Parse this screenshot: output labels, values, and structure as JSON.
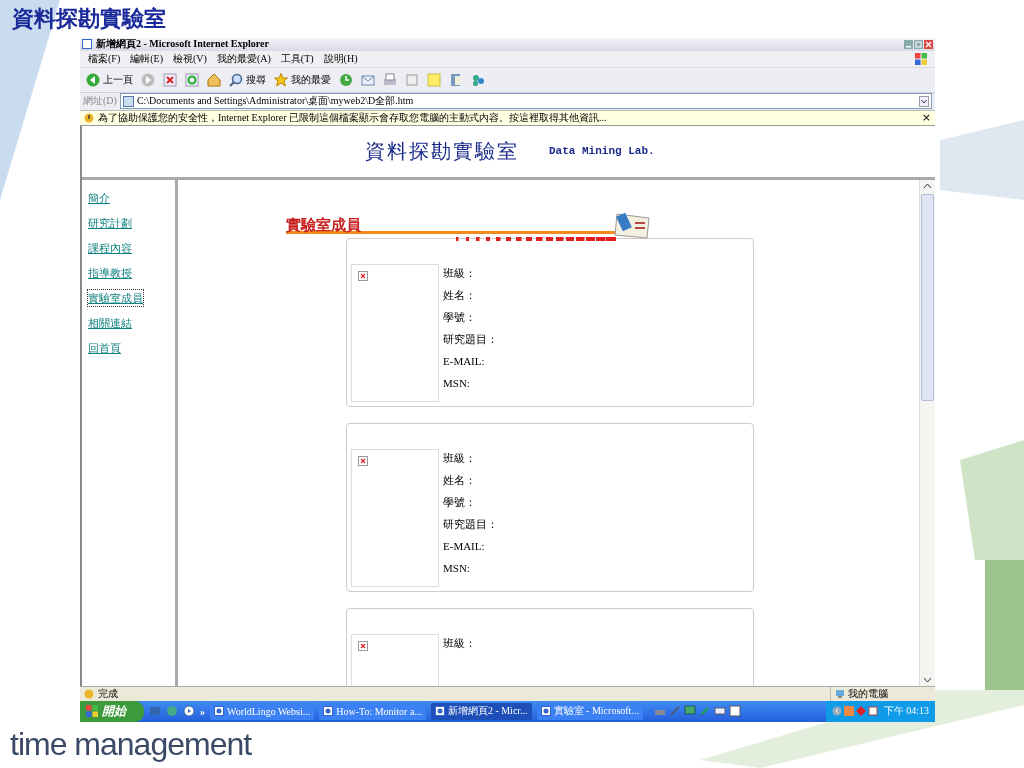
{
  "slide_title": "資料探勘實驗室",
  "window": {
    "title": "新增網頁2 - Microsoft Internet Explorer"
  },
  "menu": [
    "檔案(F)",
    "編輯(E)",
    "檢視(V)",
    "我的最愛(A)",
    "工具(T)",
    "說明(H)"
  ],
  "toolbar": [
    {
      "kind": "back",
      "label": "上一頁"
    },
    {
      "kind": "forward"
    },
    {
      "kind": "stop"
    },
    {
      "kind": "refresh"
    },
    {
      "kind": "home"
    },
    {
      "kind": "search",
      "label": "搜尋"
    },
    {
      "kind": "favorites",
      "label": "我的最愛"
    },
    {
      "kind": "history"
    },
    {
      "kind": "mail"
    },
    {
      "kind": "print"
    },
    {
      "kind": "edit"
    },
    {
      "kind": "notes"
    },
    {
      "kind": "research"
    },
    {
      "kind": "messenger"
    }
  ],
  "address": {
    "label": "網址(D)",
    "value": "C:\\Documents and Settings\\Administrator\\桌面\\myweb2\\D全部.htm"
  },
  "info_bar": {
    "text": "為了協助保護您的安全性，Internet Explorer 已限制這個檔案顯示會存取您電腦的主動式內容。按這裡取得其他資訊...",
    "close": "×"
  },
  "page": {
    "title": "資料探勘實驗室",
    "subtitle": "Data Mining Lab.",
    "nav": [
      {
        "label": "簡介",
        "selected": false
      },
      {
        "label": "研究計劃",
        "selected": false
      },
      {
        "label": "課程內容",
        "selected": false
      },
      {
        "label": "指導教授",
        "selected": false
      },
      {
        "label": "實驗室成員",
        "selected": true
      },
      {
        "label": "相關連結",
        "selected": false
      },
      {
        "label": "回首頁",
        "selected": false
      }
    ],
    "section_title": "實驗室成員",
    "cards": [
      {
        "fields": [
          "班級：",
          "姓名：",
          "學號：",
          "研究題目：",
          "E-MAIL:",
          "MSN:"
        ]
      },
      {
        "fields": [
          "班級：",
          "姓名：",
          "學號：",
          "研究題目：",
          "E-MAIL:",
          "MSN:"
        ]
      },
      {
        "fields": [
          "班級："
        ]
      }
    ]
  },
  "status_bar": {
    "text": "完成",
    "zone": "我的電腦"
  },
  "taskbar": {
    "start": "開始",
    "more": "»",
    "tasks": [
      {
        "label": "WorldLingo Websi...",
        "selected": false
      },
      {
        "label": "How-To: Monitor a...",
        "selected": false
      },
      {
        "label": "新增網頁2 - Micr...",
        "selected": true
      },
      {
        "label": "實驗室 - Microsoft...",
        "selected": false
      }
    ],
    "clock": "下午 04:13"
  },
  "footer": "time management"
}
